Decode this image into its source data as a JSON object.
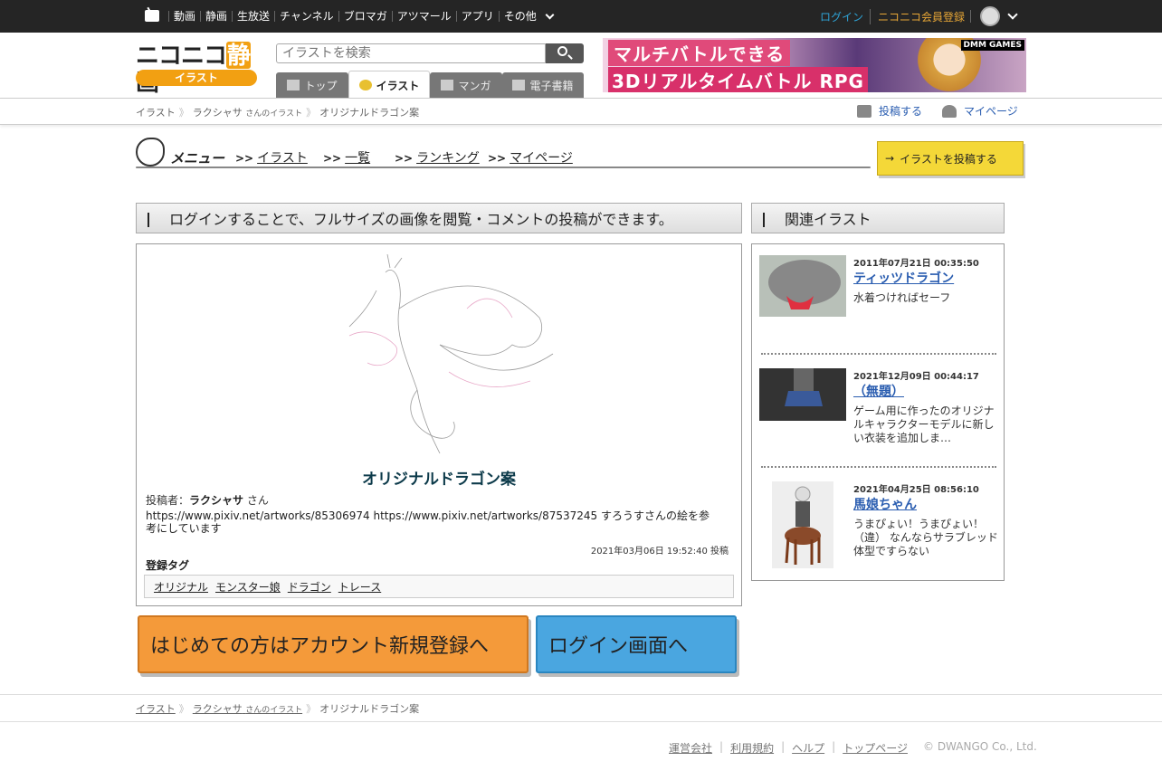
{
  "topbar": {
    "nav": [
      "動画",
      "静画",
      "生放送",
      "チャンネル",
      "ブロマガ",
      "アツマール",
      "アプリ",
      "その他"
    ],
    "login": "ログイン",
    "register": "ニコニコ会員登録"
  },
  "header": {
    "logo_text": "ニコニコ",
    "logo_highlight": "静",
    "logo_end": "画",
    "logo_sub": "イラスト",
    "search_placeholder": "イラストを検索",
    "tabs": [
      {
        "label": "トップ"
      },
      {
        "label": "イラスト"
      },
      {
        "label": "マンガ"
      },
      {
        "label": "電子書籍"
      }
    ],
    "banner": {
      "line1": "マルチバトルできる",
      "line2": "3Dリアルタイムバトル RPG",
      "brand": "DMM GAMES"
    }
  },
  "breadcrumb": {
    "root": "イラスト",
    "user": "ラクシャサ",
    "user_suffix": "さんのイラスト",
    "current": "オリジナルドラゴン案",
    "post": "投稿する",
    "mypage": "マイページ"
  },
  "menu": {
    "title": "メニュー",
    "items": [
      "イラスト",
      "一覧",
      "ランキング",
      "マイページ"
    ],
    "post_button": "イラストを投稿する"
  },
  "notice": "ログインすることで、フルサイズの画像を閲覧・コメントの投稿ができます。",
  "illust": {
    "title": "オリジナルドラゴン案",
    "author_label": "投稿者：",
    "author": "ラクシャサ",
    "author_suffix": "さん",
    "description": "https://www.pixiv.net/artworks/85306974 https://www.pixiv.net/artworks/87537245 すろうすさんの絵を参考にしています",
    "date": "2021年03月06日 19:52:40 投稿",
    "tags_label": "登録タグ",
    "tags": [
      "オリジナル",
      "モンスター娘",
      "ドラゴン",
      "トレース"
    ]
  },
  "buttons": {
    "register": "はじめての方はアカウント新規登録へ",
    "login": "ログイン画面へ"
  },
  "related": {
    "title": "関連イラスト",
    "items": [
      {
        "date": "2011年07月21日 00:35:50",
        "name": "ティッツドラゴン",
        "caption": "水着つければセーフ"
      },
      {
        "date": "2021年12月09日 00:44:17",
        "name": "（無題）",
        "caption": "ゲーム用に作ったのオリジナルキャラクターモデルに新しい衣装を追加しま…"
      },
      {
        "date": "2021年04月25日 08:56:10",
        "name": "馬娘ちゃん",
        "caption": "うまぴょい！うまぴょい！（違） なんならサラブレッド体型ですらない"
      }
    ]
  },
  "footer": {
    "links": [
      "運営会社",
      "利用規約",
      "ヘルプ",
      "トップページ"
    ],
    "copyright": "© DWANGO Co., Ltd."
  }
}
